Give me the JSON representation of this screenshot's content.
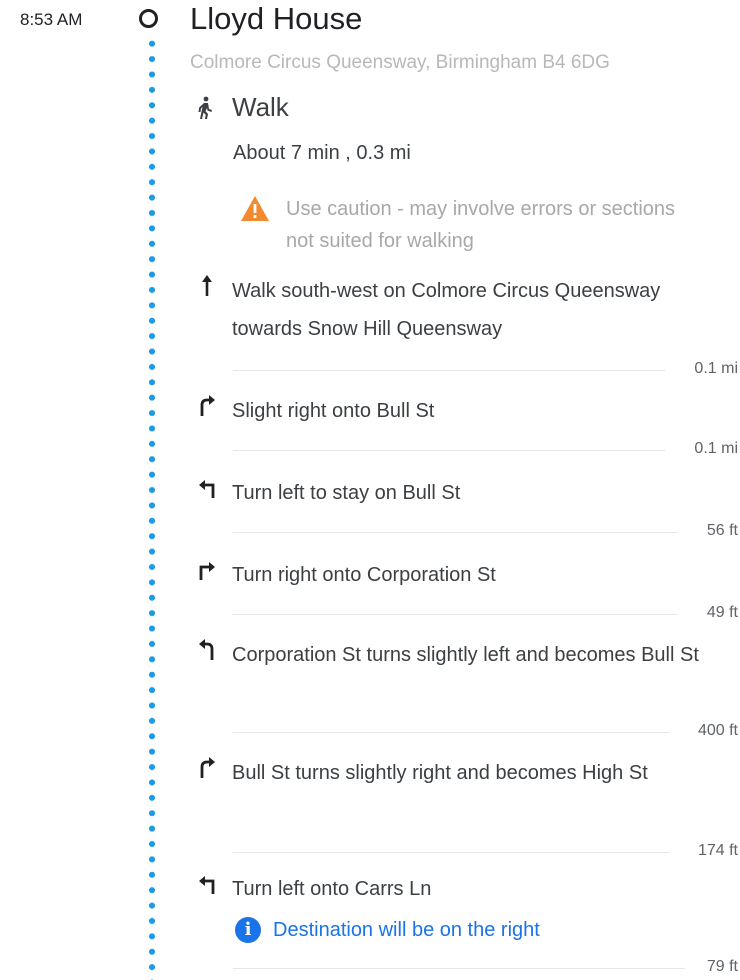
{
  "departure": {
    "time": "8:53 AM",
    "place_name": "Lloyd House",
    "address": "Colmore Circus Queensway, Birmingham B4 6DG"
  },
  "segment": {
    "mode_icon": "walk-icon",
    "mode_label": "Walk",
    "summary": "About 7 min , 0.3 mi",
    "warning": "Use caution - may involve errors or sections not suited for walking",
    "colors": {
      "route_dots": "#1a9be6",
      "warning": "#f28b30",
      "info": "#1a73e8"
    }
  },
  "steps": [
    {
      "icon": "arrow-up-icon",
      "text": "Walk south-west on Colmore Circus Queensway towards Snow Hill Queensway",
      "distance": "0.1 mi"
    },
    {
      "icon": "slight-right-icon",
      "text": "Slight right onto Bull St",
      "distance": "0.1 mi"
    },
    {
      "icon": "turn-left-icon",
      "text": "Turn left to stay on Bull St",
      "distance": "56 ft"
    },
    {
      "icon": "turn-right-icon",
      "text": "Turn right onto Corporation St",
      "distance": "49 ft"
    },
    {
      "icon": "slight-left-icon",
      "text": "Corporation St turns slightly left and becomes Bull St",
      "distance": "400 ft"
    },
    {
      "icon": "slight-right-icon",
      "text": "Bull St turns slightly right and becomes High St",
      "distance": "174 ft"
    },
    {
      "icon": "turn-left-icon",
      "text": "Turn left onto Carrs Ln",
      "note": "Destination will be on the right",
      "distance": "79 ft"
    }
  ]
}
